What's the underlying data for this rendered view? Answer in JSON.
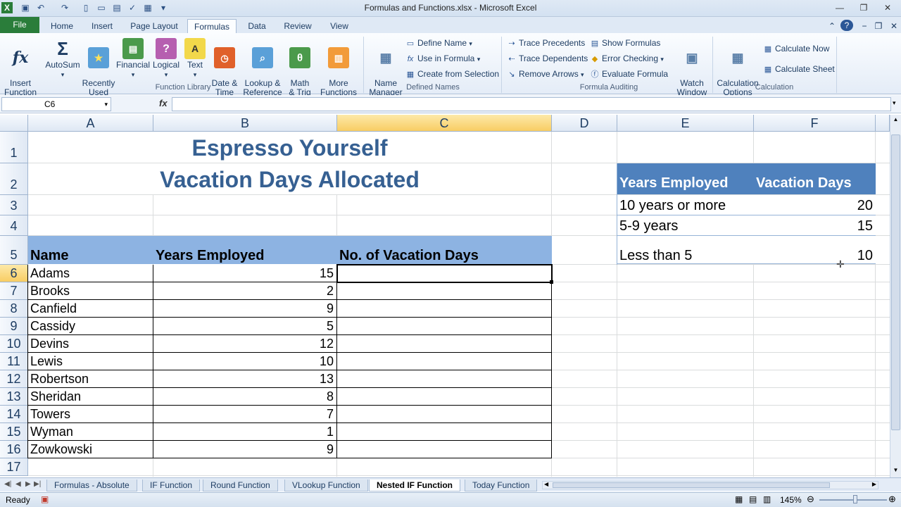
{
  "window": {
    "title": "Formulas and Functions.xlsx  -  Microsoft Excel"
  },
  "ribbon_tabs": [
    {
      "label": "File"
    },
    {
      "label": "Home"
    },
    {
      "label": "Insert"
    },
    {
      "label": "Page Layout"
    },
    {
      "label": "Formulas"
    },
    {
      "label": "Data"
    },
    {
      "label": "Review"
    },
    {
      "label": "View"
    }
  ],
  "ribbon": {
    "function_library": {
      "group_label": "Function Library",
      "insert_function": "Insert\nFunction",
      "autosum": "AutoSum",
      "recently_used": "Recently\nUsed",
      "financial": "Financial",
      "logical": "Logical",
      "text": "Text",
      "date_time": "Date &\nTime",
      "lookup_reference": "Lookup &\nReference",
      "math_trig": "Math\n& Trig",
      "more_functions": "More\nFunctions"
    },
    "defined_names": {
      "group_label": "Defined Names",
      "name_manager": "Name\nManager",
      "define_name": "Define Name",
      "use_in_formula": "Use in Formula",
      "create_from_selection": "Create from Selection"
    },
    "formula_auditing": {
      "group_label": "Formula Auditing",
      "trace_precedents": "Trace Precedents",
      "trace_dependents": "Trace Dependents",
      "remove_arrows": "Remove Arrows",
      "show_formulas": "Show Formulas",
      "error_checking": "Error Checking",
      "evaluate_formula": "Evaluate Formula",
      "watch_window": "Watch\nWindow"
    },
    "calculation": {
      "group_label": "Calculation",
      "calculation_options": "Calculation\nOptions",
      "calculate_now": "Calculate Now",
      "calculate_sheet": "Calculate Sheet"
    }
  },
  "formula_bar": {
    "name_box": "C6",
    "fx": "fx",
    "formula": ""
  },
  "columns": [
    "A",
    "B",
    "C",
    "D",
    "E",
    "F"
  ],
  "rows": [
    "1",
    "2",
    "3",
    "4",
    "5",
    "6",
    "7",
    "8",
    "9",
    "10",
    "11",
    "12",
    "13",
    "14",
    "15",
    "16",
    "17"
  ],
  "sheet": {
    "title_line1": "Espresso Yourself",
    "title_line2": "Vacation Days Allocated",
    "headers": {
      "name": "Name",
      "years": "Years Employed",
      "days": "No. of Vacation Days"
    },
    "employees": [
      {
        "name": "Adams",
        "years": "15"
      },
      {
        "name": "Brooks",
        "years": "2"
      },
      {
        "name": "Canfield",
        "years": "9"
      },
      {
        "name": "Cassidy",
        "years": "5"
      },
      {
        "name": "Devins",
        "years": "12"
      },
      {
        "name": "Lewis",
        "years": "10"
      },
      {
        "name": "Robertson",
        "years": "13"
      },
      {
        "name": "Sheridan",
        "years": "8"
      },
      {
        "name": "Towers",
        "years": "7"
      },
      {
        "name": "Wyman",
        "years": "1"
      },
      {
        "name": "Zowkowski",
        "years": "9"
      }
    ],
    "lookup": {
      "header_years": "Years Employed",
      "header_days": "Vacation Days",
      "rows": [
        {
          "years": "10 years or more",
          "days": "20"
        },
        {
          "years": "5-9 years",
          "days": "15"
        },
        {
          "years": "Less than 5",
          "days": "10"
        }
      ]
    }
  },
  "sheet_tabs": [
    {
      "label": "Formulas - Absolute"
    },
    {
      "label": "IF Function"
    },
    {
      "label": "Round Function"
    },
    {
      "label": "VLookup Function"
    },
    {
      "label": "Nested IF Function",
      "active": true
    },
    {
      "label": "Today Function"
    }
  ],
  "status": {
    "ready": "Ready",
    "zoom": "145%"
  }
}
